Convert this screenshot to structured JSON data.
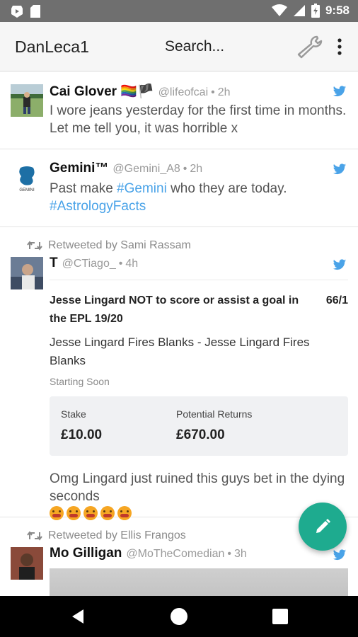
{
  "status_bar": {
    "time": "9:58"
  },
  "app_bar": {
    "title": "DanLeca1",
    "search_placeholder": "Search..."
  },
  "colors": {
    "accent": "#1eab8f",
    "twitter_blue": "#4aa3e8",
    "status_bar": "#6f6f6f"
  },
  "tweets": [
    {
      "name": "Cai Glover 🏳️‍🌈🏴",
      "handle": "@lifeofcai",
      "time": "2h",
      "text": "I wore jeans yesterday for the first time in months. Let me tell you, it was horrible x"
    },
    {
      "name": "Gemini™",
      "handle": "@Gemini_A8",
      "time": "2h",
      "text_prefix": "Past make ",
      "hashtag1": "#Gemini",
      "text_middle": " who they are today.",
      "hashtag2": "#AstrologyFacts",
      "avatar_caption": "GEMINI"
    },
    {
      "retweeted_by": "Retweeted by Sami Rassam",
      "name": "T",
      "handle": "@CTiago_",
      "time": "4h",
      "bet": {
        "title": "Jesse Lingard NOT to score or assist a goal in the EPL 19/20",
        "odds": "66/1",
        "subtitle": "Jesse Lingard Fires Blanks - Jesse Lingard Fires Blanks",
        "status": "Starting Soon",
        "stake_label": "Stake",
        "stake_value": "£10.00",
        "returns_label": "Potential Returns",
        "returns_value": "£670.00"
      },
      "text": "Omg Lingard just ruined this guys bet in the dying seconds"
    },
    {
      "retweeted_by": "Retweeted by Ellis Frangos",
      "name": "Mo Gilligan",
      "handle": "@MoTheComedian",
      "time": "3h"
    }
  ],
  "icons": {
    "bird": "twitter-bird-icon",
    "retweet": "retweet-icon",
    "wrench": "wrench-icon",
    "more": "more-vert-icon",
    "compose": "pencil-icon"
  }
}
